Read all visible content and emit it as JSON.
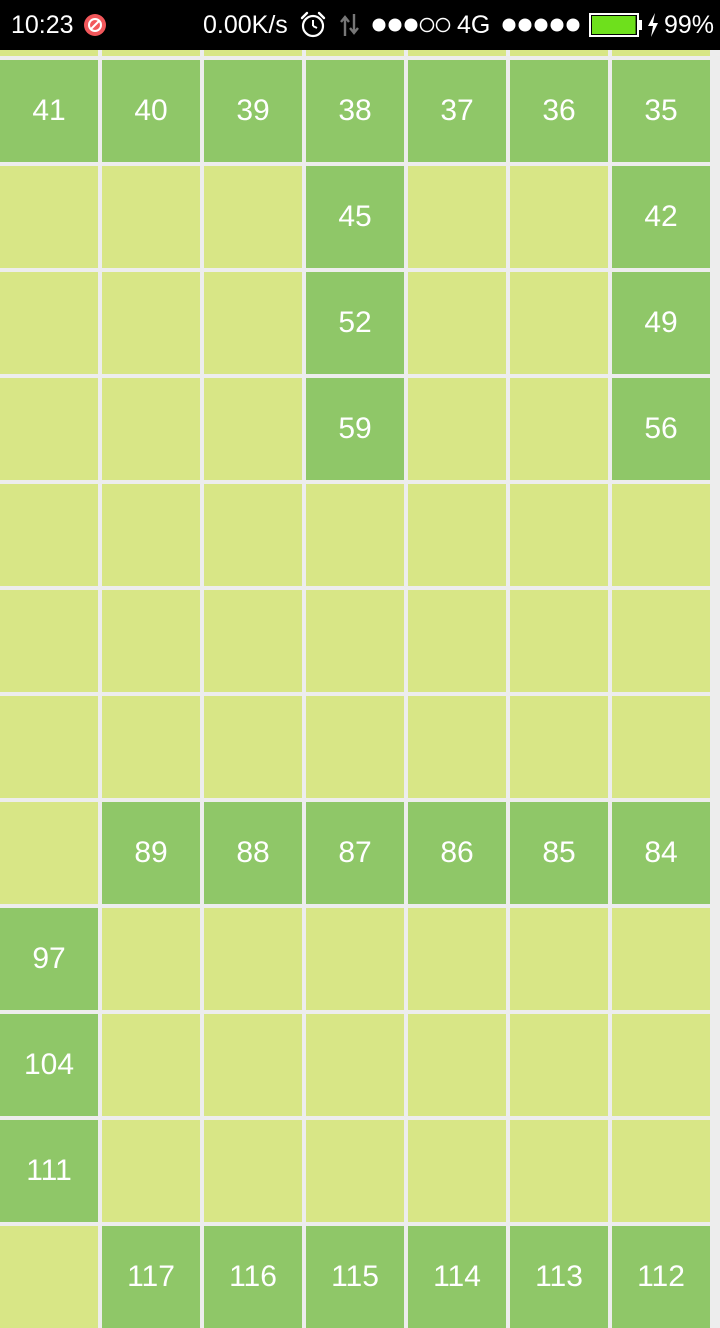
{
  "status_bar": {
    "time": "10:23",
    "network_speed": "0.00K/s",
    "network_type": "4G",
    "battery_percent": "99%",
    "signal_sim1_bars": 3,
    "signal_sim1_max": 5,
    "signal_sim2_bars": 5,
    "signal_sim2_max": 5,
    "battery_level": 0.99,
    "icons": [
      "blocked-notification-icon",
      "alarm-clock-icon",
      "data-transfer-icon",
      "signal-strength-icon",
      "battery-icon",
      "charging-bolt-icon"
    ]
  },
  "board": {
    "colors": {
      "path_cell": "#8fc768",
      "empty_cell": "#d8e686",
      "grid_line": "#ededed"
    },
    "columns": 7,
    "rows": [
      [
        "",
        "",
        "",
        "",
        "",
        "",
        ""
      ],
      [
        "41",
        "40",
        "39",
        "38",
        "37",
        "36",
        "35"
      ],
      [
        "",
        "",
        "",
        "45",
        "",
        "",
        "42"
      ],
      [
        "",
        "",
        "",
        "52",
        "",
        "",
        "49"
      ],
      [
        "",
        "",
        "",
        "59",
        "",
        "",
        "56"
      ],
      [
        "",
        "",
        "",
        "",
        "",
        "",
        ""
      ],
      [
        "",
        "",
        "",
        "",
        "",
        "",
        ""
      ],
      [
        "",
        "",
        "",
        "",
        "",
        "",
        ""
      ],
      [
        "",
        "89",
        "88",
        "87",
        "86",
        "85",
        "84"
      ],
      [
        "97",
        "",
        "",
        "",
        "",
        "",
        ""
      ],
      [
        "104",
        "",
        "",
        "",
        "",
        "",
        ""
      ],
      [
        "111",
        "",
        "",
        "",
        "",
        "",
        ""
      ],
      [
        "",
        "117",
        "116",
        "115",
        "114",
        "113",
        "112"
      ]
    ],
    "path_flags": [
      [
        false,
        false,
        false,
        false,
        false,
        false,
        false
      ],
      [
        true,
        true,
        true,
        true,
        true,
        true,
        true
      ],
      [
        false,
        false,
        false,
        true,
        false,
        false,
        true
      ],
      [
        false,
        false,
        false,
        true,
        false,
        false,
        true
      ],
      [
        false,
        false,
        false,
        true,
        false,
        false,
        true
      ],
      [
        false,
        false,
        false,
        false,
        false,
        false,
        false
      ],
      [
        false,
        false,
        false,
        false,
        false,
        false,
        false
      ],
      [
        false,
        false,
        false,
        false,
        false,
        false,
        false
      ],
      [
        false,
        true,
        true,
        true,
        true,
        true,
        true
      ],
      [
        true,
        false,
        false,
        false,
        false,
        false,
        false
      ],
      [
        true,
        false,
        false,
        false,
        false,
        false,
        false
      ],
      [
        true,
        false,
        false,
        false,
        false,
        false,
        false
      ],
      [
        false,
        true,
        true,
        true,
        true,
        true,
        true
      ]
    ]
  }
}
